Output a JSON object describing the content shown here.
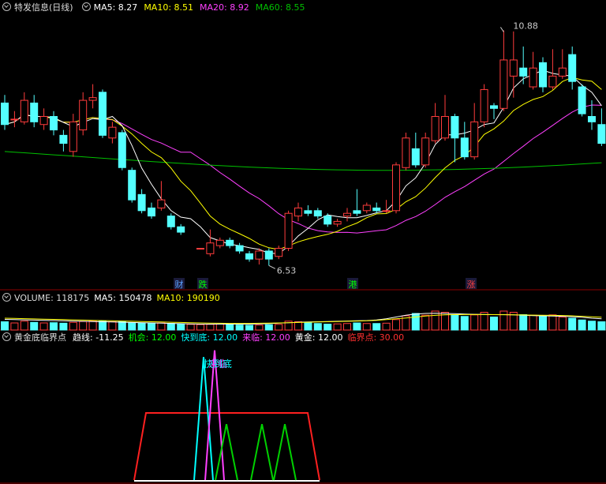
{
  "main": {
    "title": "特发信息(日线)",
    "ma": [
      {
        "label": "MA5:",
        "value": "8.27",
        "color": "#ffffff"
      },
      {
        "label": "MA10:",
        "value": "8.51",
        "color": "#ffff00"
      },
      {
        "label": "MA20:",
        "value": "8.92",
        "color": "#ff40ff"
      },
      {
        "label": "MA60:",
        "value": "8.55",
        "color": "#00c000"
      }
    ],
    "high_label": "10.88",
    "low_label": "6.53",
    "events": [
      {
        "text": "财",
        "color": "#5aa0ff"
      },
      {
        "text": "跌",
        "color": "#00ff00"
      },
      {
        "text": "港",
        "color": "#00ff00"
      },
      {
        "text": "涨",
        "color": "#ff4040"
      }
    ]
  },
  "volume": {
    "title": "VOLUME:",
    "value": "118175",
    "ma5_label": "MA5:",
    "ma5": "150478",
    "ma10_label": "MA10:",
    "ma10": "190190"
  },
  "indicator": {
    "title": "黄金底临界点",
    "items": [
      {
        "label": "趋线:",
        "value": "-11.25",
        "color": "#ffffff"
      },
      {
        "label": "机会:",
        "value": "12.00",
        "color": "#00ff00"
      },
      {
        "label": "快到底:",
        "value": "12.00",
        "color": "#00ffff"
      },
      {
        "label": "来临:",
        "value": "12.00",
        "color": "#ff40ff"
      },
      {
        "label": "黄金:",
        "value": "12.00",
        "color": "#ffffff"
      },
      {
        "label": "临界点:",
        "value": "30.00",
        "color": "#ff3030"
      }
    ],
    "annotation": "快到底",
    "annotation_top": "来临"
  },
  "chart_data": {
    "type": "candlestick",
    "colors": {
      "up": "#ff3c3c",
      "down": "#54ffff",
      "ma5": "#ffffff",
      "ma10": "#ffff00",
      "ma20": "#ff40ff",
      "ma60": "#00c000"
    },
    "ylim": [
      6.3,
      11.2
    ],
    "candles": [
      [
        9.55,
        9.15,
        9.7,
        9.05
      ],
      [
        9.25,
        9.25,
        9.4,
        9.1
      ],
      [
        9.2,
        9.6,
        9.75,
        9.15
      ],
      [
        9.55,
        9.2,
        9.7,
        9.1
      ],
      [
        9.15,
        9.3,
        9.45,
        9.05
      ],
      [
        9.3,
        9.05,
        9.4,
        8.95
      ],
      [
        8.95,
        8.8,
        9.05,
        8.65
      ],
      [
        8.65,
        9.2,
        9.35,
        8.55
      ],
      [
        9.05,
        9.6,
        9.75,
        8.95
      ],
      [
        9.6,
        9.65,
        9.9,
        9.45
      ],
      [
        9.75,
        8.95,
        9.8,
        8.9
      ],
      [
        8.9,
        9.1,
        9.2,
        8.8
      ],
      [
        9.0,
        8.35,
        9.05,
        8.3
      ],
      [
        8.3,
        7.75,
        8.35,
        7.7
      ],
      [
        7.85,
        7.55,
        7.95,
        7.5
      ],
      [
        7.6,
        7.45,
        7.7,
        7.4
      ],
      [
        7.6,
        7.75,
        8.1,
        7.55
      ],
      [
        7.45,
        7.25,
        7.5,
        7.2
      ],
      [
        7.25,
        7.15,
        7.3,
        7.1
      ],
      [
        null,
        null,
        null,
        null
      ],
      [
        6.85,
        6.85,
        6.85,
        6.85
      ],
      [
        6.75,
        6.95,
        7.2,
        6.7
      ],
      [
        6.9,
        7.0,
        7.05,
        6.85
      ],
      [
        7.0,
        6.9,
        7.05,
        6.85
      ],
      [
        6.9,
        6.8,
        6.95,
        6.75
      ],
      [
        6.75,
        6.65,
        6.8,
        6.6
      ],
      [
        6.65,
        6.8,
        6.85,
        6.55
      ],
      [
        6.8,
        6.65,
        6.85,
        6.53
      ],
      [
        6.7,
        6.85,
        6.9,
        6.65
      ],
      [
        6.85,
        7.5,
        7.55,
        6.8
      ],
      [
        7.45,
        7.6,
        7.7,
        7.35
      ],
      [
        7.55,
        7.5,
        7.65,
        7.45
      ],
      [
        7.55,
        7.45,
        7.6,
        7.4
      ],
      [
        7.45,
        7.3,
        7.5,
        7.25
      ],
      [
        7.3,
        7.35,
        7.4,
        7.25
      ],
      [
        7.45,
        7.5,
        7.6,
        7.35
      ],
      [
        7.55,
        7.5,
        7.95,
        7.45
      ],
      [
        7.55,
        7.65,
        7.7,
        7.5
      ],
      [
        7.6,
        7.55,
        7.7,
        7.5
      ],
      [
        7.55,
        7.55,
        7.75,
        7.5
      ],
      [
        7.55,
        8.4,
        8.45,
        7.5
      ],
      [
        8.35,
        8.9,
        9.0,
        8.3
      ],
      [
        8.7,
        8.4,
        9.0,
        8.35
      ],
      [
        8.4,
        8.9,
        9.0,
        8.35
      ],
      [
        8.85,
        9.3,
        9.55,
        8.8
      ],
      [
        8.9,
        9.3,
        9.7,
        8.85
      ],
      [
        9.3,
        8.9,
        9.35,
        8.45
      ],
      [
        8.9,
        8.55,
        9.2,
        8.5
      ],
      [
        8.55,
        9.2,
        9.55,
        8.5
      ],
      [
        9.2,
        9.8,
        9.9,
        9.1
      ],
      [
        9.5,
        9.45,
        9.55,
        9.25
      ],
      [
        9.45,
        10.35,
        10.9,
        9.4
      ],
      [
        10.05,
        10.35,
        10.88,
        9.65
      ],
      [
        10.2,
        10.05,
        10.6,
        9.9
      ],
      [
        9.85,
        10.2,
        10.5,
        9.8
      ],
      [
        10.3,
        9.85,
        10.4,
        9.75
      ],
      [
        9.85,
        10.05,
        10.55,
        9.8
      ],
      [
        10.05,
        10.2,
        10.55,
        10.0
      ],
      [
        10.45,
        9.95,
        10.6,
        9.8
      ],
      [
        9.85,
        9.35,
        9.9,
        9.3
      ],
      [
        9.3,
        9.2,
        9.6,
        9.05
      ],
      [
        9.15,
        8.8,
        9.45,
        8.75
      ]
    ],
    "volume": {
      "values": [
        70,
        60,
        75,
        65,
        60,
        62,
        58,
        65,
        72,
        78,
        75,
        70,
        72,
        60,
        58,
        55,
        60,
        56,
        52,
        48,
        46,
        48,
        50,
        44,
        42,
        40,
        42,
        45,
        48,
        75,
        70,
        60,
        55,
        50,
        52,
        55,
        60,
        55,
        55,
        58,
        88,
        120,
        140,
        125,
        160,
        150,
        130,
        115,
        128,
        150,
        110,
        160,
        150,
        130,
        125,
        115,
        128,
        110,
        100,
        85,
        75,
        70
      ],
      "ma5": [
        90,
        88,
        86,
        84,
        82,
        80,
        78,
        76,
        74,
        72,
        70,
        68,
        66,
        64,
        62,
        60,
        58,
        56,
        54,
        52,
        50,
        50,
        50,
        50,
        50,
        50,
        52,
        54,
        58,
        62,
        66,
        68,
        70,
        72,
        74,
        76,
        78,
        80,
        85,
        95,
        110,
        125,
        135,
        140,
        142,
        140,
        138,
        135,
        133,
        132,
        130,
        130,
        128,
        125,
        122,
        120,
        118,
        116,
        113,
        108,
        100,
        95
      ],
      "ma10": [
        100,
        98,
        96,
        94,
        92,
        90,
        88,
        86,
        84,
        82,
        80,
        78,
        76,
        74,
        72,
        70,
        68,
        66,
        64,
        62,
        60,
        58,
        57,
        56,
        56,
        56,
        57,
        58,
        60,
        62,
        64,
        66,
        68,
        70,
        72,
        74,
        76,
        78,
        82,
        88,
        95,
        102,
        110,
        118,
        124,
        128,
        130,
        131,
        131,
        131,
        130,
        129,
        128,
        127,
        126,
        125,
        124,
        123,
        120,
        116,
        112,
        108
      ],
      "ylim": [
        0,
        200
      ]
    },
    "indicator": {
      "ylim": [
        0,
        60
      ]
    }
  }
}
